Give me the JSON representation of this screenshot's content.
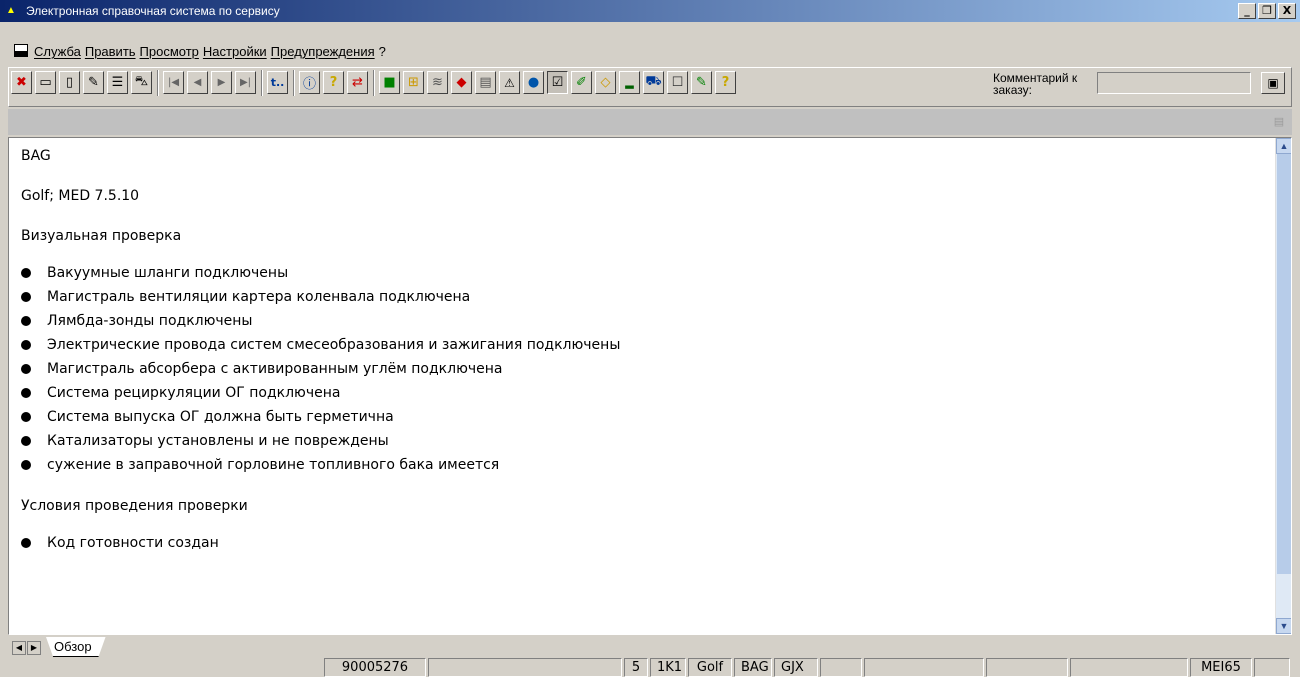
{
  "window": {
    "title": "Электронная справочная система по сервису",
    "buttons": [
      "_",
      "🗗",
      "X"
    ]
  },
  "menu": {
    "items": [
      "Служба",
      "Править",
      "Просмотр",
      "Настройки",
      "Предупреждения",
      "?"
    ]
  },
  "toolbar": {
    "comment_label": "Комментарий к заказу:",
    "comment_value": ""
  },
  "content": {
    "header1": "BAG",
    "header2": "Golf; MED 7.5.10",
    "section1_title": "Визуальная проверка",
    "section1_items": [
      "Вакуумные шланги подключены",
      "Магистраль вентиляции картера коленвала подключена",
      "Лямбда-зонды подключены",
      "Электрические провода систем смесеобразования и зажигания подключены",
      "Магистраль абсорбера с активированным углём подключена",
      "Система рециркуляции ОГ подключена",
      "Система выпуска ОГ должна быть герметична",
      "Катализаторы установлены и не повреждены",
      "сужение в заправочной горловине топливного бака имеется"
    ],
    "section2_title": "Условия проведения проверки",
    "section2_items": [
      "Код готовности создан"
    ]
  },
  "tabs": {
    "active": "Обзор"
  },
  "status": {
    "order": "90005276",
    "f1": "",
    "f2": "5",
    "f3": "1K1",
    "f4": "Golf",
    "f5": "BAG",
    "f6": "GJX",
    "f7": "",
    "f8": "",
    "f9": "",
    "f10": "",
    "f11": "MEI65",
    "f12": ""
  }
}
